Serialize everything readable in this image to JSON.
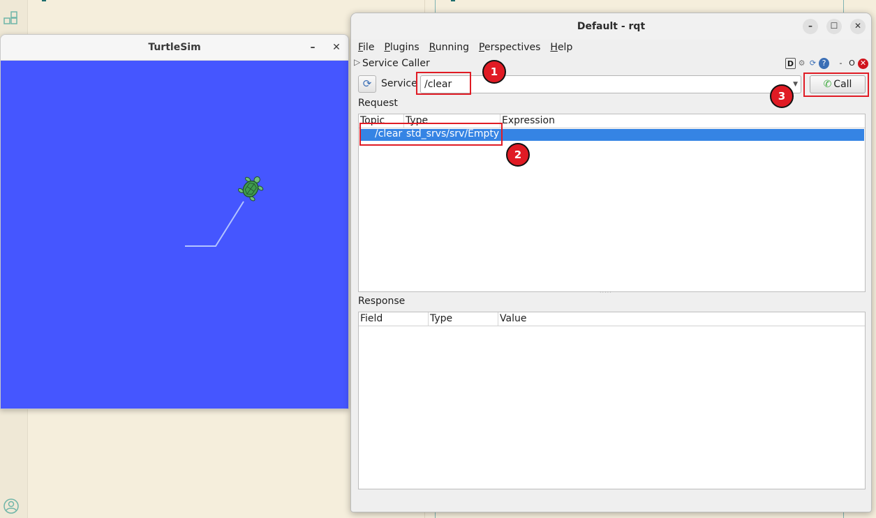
{
  "desktop": {
    "dock_top_icon": "apps-grid-icon",
    "dock_bottom_icon": "user-account-icon"
  },
  "turtlesim": {
    "title": "TurtleSim",
    "minimize_glyph": "–",
    "close_glyph": "✕",
    "canvas_color": "#4556ff",
    "turtle_icon": "turtle-icon",
    "trail_color": "#b3c4ff"
  },
  "rqt": {
    "title": "Default - rqt",
    "window_buttons": {
      "minimize": "–",
      "maximize": "☐",
      "close": "✕"
    },
    "menu": [
      "File",
      "Plugins",
      "Running",
      "Perspectives",
      "Help"
    ],
    "plugin": {
      "title": "Service Caller",
      "expand_glyph": "▷",
      "icons": [
        "D",
        "⚙",
        "⟳",
        "?"
      ],
      "dash": "-",
      "float": "O",
      "close": "✕"
    },
    "service": {
      "refresh_glyph": "⟳",
      "label": "Service",
      "value": "/clear",
      "dropdown_glyph": "▼",
      "call_label": "Call",
      "call_icon": "✆"
    },
    "request": {
      "label": "Request",
      "columns": [
        "Topic",
        "Type",
        "Expression"
      ],
      "rows": [
        {
          "topic": "/clear",
          "type": "std_srvs/srv/Empty",
          "expression": ""
        }
      ]
    },
    "splitter_grip": "·····",
    "response": {
      "label": "Response",
      "columns": [
        "Field",
        "Type",
        "Value"
      ]
    }
  },
  "annotations": {
    "badge_1": "1",
    "badge_2": "2",
    "badge_3": "3",
    "highlight_color": "#e01b24"
  }
}
